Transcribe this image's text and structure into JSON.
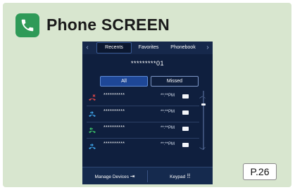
{
  "header": {
    "title": "Phone SCREEN",
    "icon": "phone-icon",
    "icon_color": "#2f9a58"
  },
  "screen": {
    "tabs": [
      {
        "label": "Recents",
        "active": true
      },
      {
        "label": "Favorites",
        "active": false
      },
      {
        "label": "Phonebook",
        "active": false
      }
    ],
    "number_display": "*********01",
    "filters": [
      {
        "label": "All",
        "selected": true
      },
      {
        "label": "Missed",
        "selected": false
      }
    ],
    "calls": [
      {
        "type": "missed",
        "name": "**********",
        "time": "**:**PM",
        "icon": "missed-call-icon"
      },
      {
        "type": "outgoing",
        "name": "**********",
        "time": "**:**PM",
        "icon": "outgoing-call-icon"
      },
      {
        "type": "incoming",
        "name": "**********",
        "time": "**:**PM",
        "icon": "incoming-call-icon"
      },
      {
        "type": "outgoing",
        "name": "**********",
        "time": "**:**PM",
        "icon": "outgoing-call-icon"
      }
    ],
    "manage_devices_label": "Manage Devices",
    "keypad_label": "Keypad"
  },
  "page_ref": "P.26",
  "colors": {
    "card_bg": "#d8e6cf",
    "screen_bg": "#0f1f3e",
    "missed": "#e04848",
    "outgoing": "#3ea3e8",
    "incoming": "#3ec86a"
  }
}
